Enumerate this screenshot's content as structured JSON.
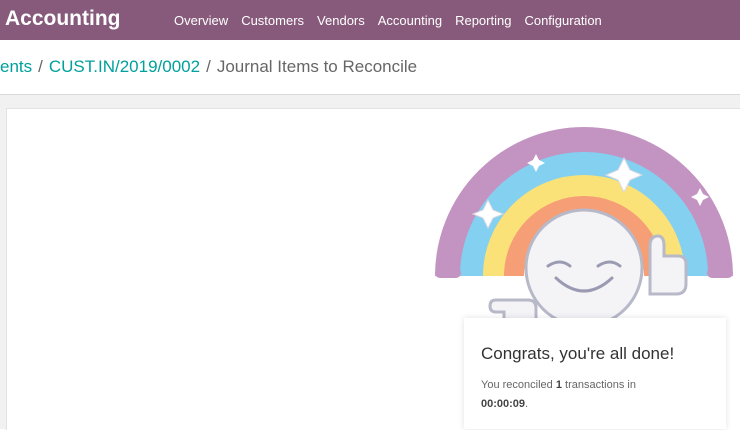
{
  "app": {
    "title": "Accounting"
  },
  "menu": {
    "items": [
      "Overview",
      "Customers",
      "Vendors",
      "Accounting",
      "Reporting",
      "Configuration"
    ]
  },
  "breadcrumb": {
    "parent_partial": "ents",
    "record": "CUST.IN/2019/0002",
    "current": "Journal Items to Reconcile",
    "separator": "/"
  },
  "done": {
    "title": "Congrats, you're all done!",
    "text_before": "You reconciled ",
    "count": "1",
    "text_after": " transactions in",
    "time": "00:00:09",
    "period": "."
  },
  "colors": {
    "brand": "#875a7b",
    "link": "#00a09d"
  }
}
